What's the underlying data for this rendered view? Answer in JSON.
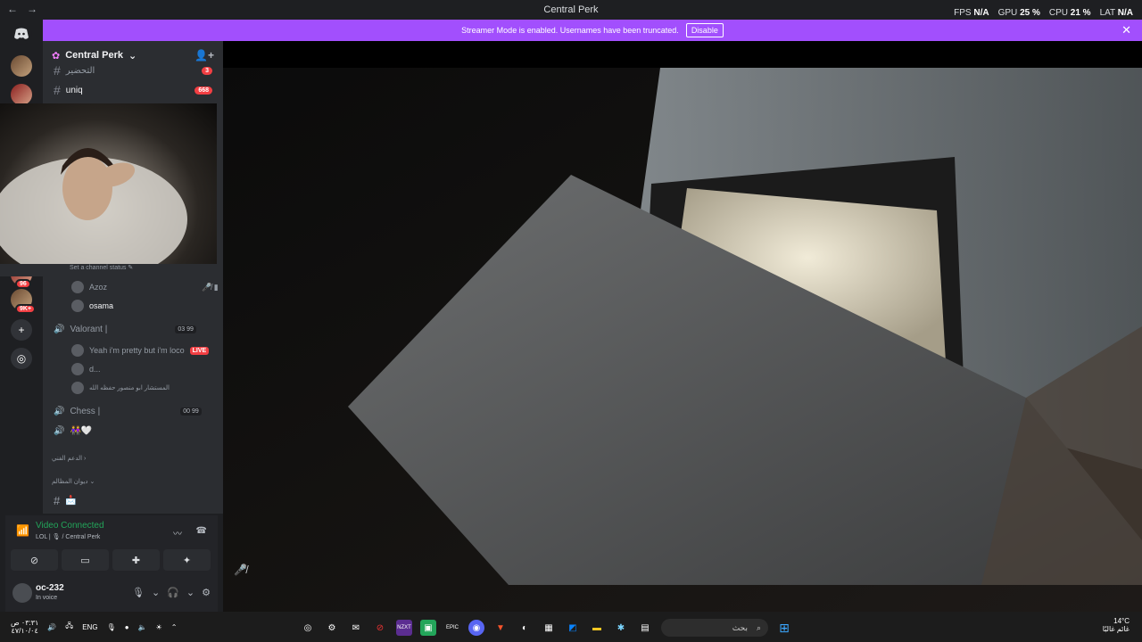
{
  "titlebar": {
    "title": "Central Perk",
    "fps_label": "FPS",
    "fps": "N/A",
    "gpu_label": "GPU",
    "gpu": "25 %",
    "cpu_label": "CPU",
    "cpu": "21 %",
    "lat_label": "LAT",
    "lat": "N/A"
  },
  "banner": {
    "text": "Streamer Mode is enabled. Usernames have been truncated.",
    "disable": "Disable"
  },
  "servers": {
    "badge1": "96",
    "badge2": "9K+"
  },
  "server": {
    "name": "Central Perk"
  },
  "channels": [
    {
      "name": "التحضير",
      "count": "3"
    },
    {
      "name": "uniq",
      "count": "668"
    }
  ],
  "camera": {
    "status": "Set a channel status"
  },
  "voice_users": [
    {
      "name": "Azoz"
    },
    {
      "name": "osama"
    }
  ],
  "valorant": {
    "name": "Valorant |",
    "limit_current": "03",
    "limit_max": "99",
    "users": [
      {
        "name": "Yeah i'm pretty but i'm loco",
        "live": "LIVE"
      },
      {
        "name": "d..."
      },
      {
        "name": "المستشار ابو منصور حفظه الله"
      }
    ]
  },
  "chess": {
    "name": "Chess |",
    "limit_current": "00",
    "limit_max": "99",
    "users": [
      {
        "name": "👭🤍"
      }
    ]
  },
  "categories": [
    "الدعم الفني",
    "ديوان المظالم"
  ],
  "last_channel": {
    "name": "📩"
  },
  "voice": {
    "status": "Video Connected",
    "sub": "LOL | 🎙 / Central Perk"
  },
  "user": {
    "name": "oc-232",
    "status": "In voice"
  },
  "taskbar": {
    "lang": "ENG",
    "time": "٠٣:٣١ ص",
    "date": "٤٧/١٠/٠٤",
    "search": "بحث",
    "temp": "14°C",
    "weather": "غائم غالبًا"
  }
}
